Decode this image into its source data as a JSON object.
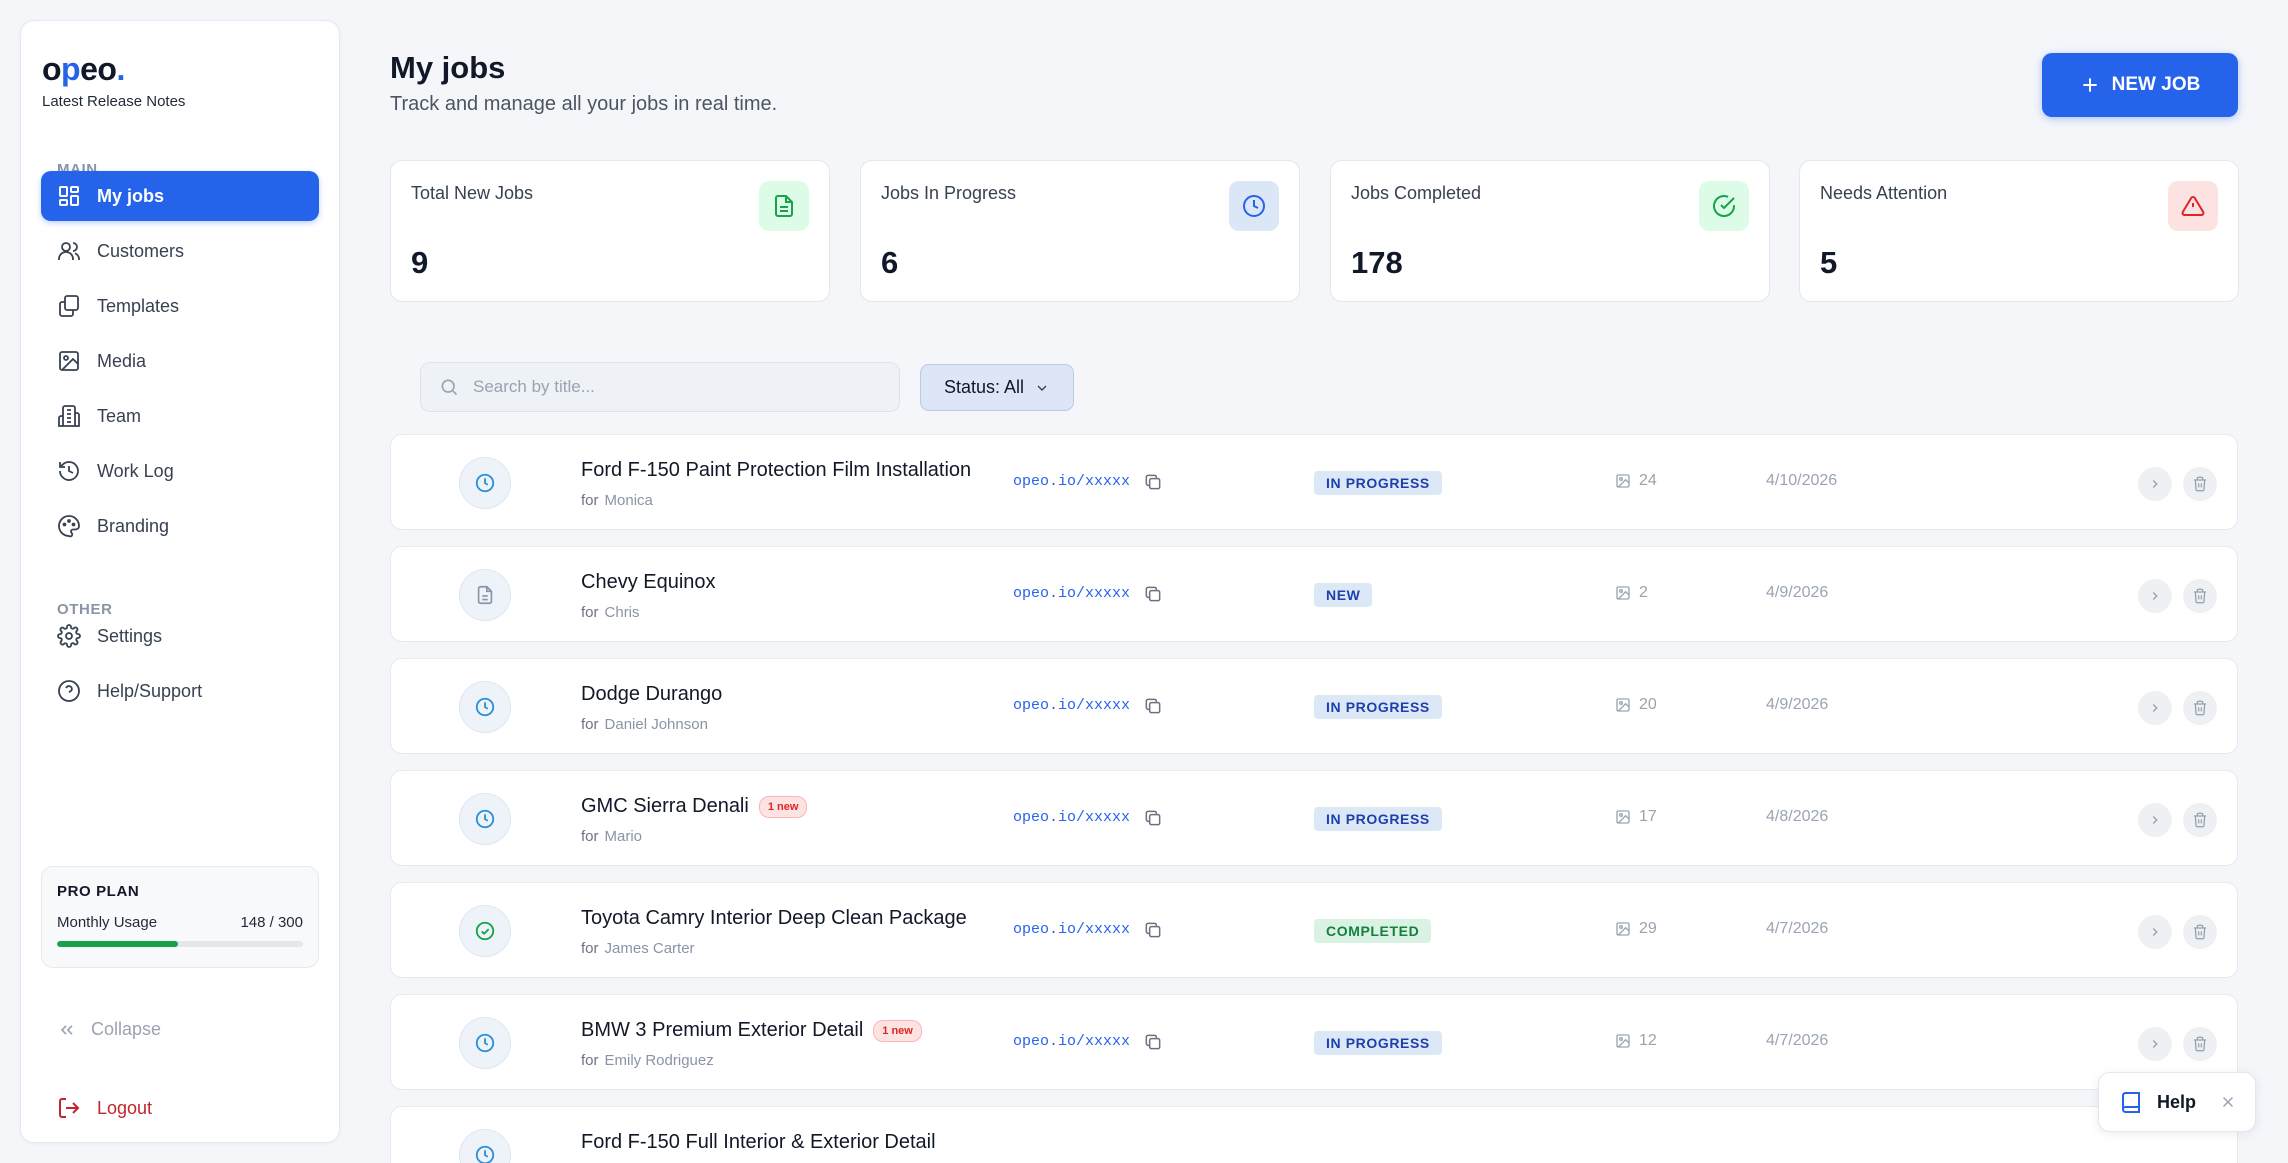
{
  "sidebar": {
    "logo_prefix": "o",
    "logo_accent": "p",
    "logo_suffix": "eo",
    "logo_dot": ".",
    "release_notes": "Latest Release Notes",
    "section_main": "MAIN",
    "section_other": "OTHER",
    "items": [
      {
        "label": "My jobs",
        "icon": "grid-icon"
      },
      {
        "label": "Customers",
        "icon": "users-icon"
      },
      {
        "label": "Templates",
        "icon": "copy-icon"
      },
      {
        "label": "Media",
        "icon": "image-icon"
      },
      {
        "label": "Team",
        "icon": "building-icon"
      },
      {
        "label": "Work Log",
        "icon": "history-icon"
      },
      {
        "label": "Branding",
        "icon": "palette-icon"
      }
    ],
    "other_items": [
      {
        "label": "Settings",
        "icon": "gear-icon"
      },
      {
        "label": "Help/Support",
        "icon": "help-circle-icon"
      }
    ],
    "plan": {
      "title": "PRO PLAN",
      "usage_label": "Monthly Usage",
      "usage_value": "148 / 300",
      "usage_fraction": 0.4933
    },
    "collapse_label": "Collapse",
    "logout_label": "Logout"
  },
  "header": {
    "title": "My jobs",
    "subtitle": "Track and manage all your jobs in real time.",
    "new_job_label": "NEW JOB"
  },
  "stats": [
    {
      "label": "Total New Jobs",
      "value": "9",
      "icon": "file-icon",
      "color": "#16a34a",
      "bg": "#dcfce7"
    },
    {
      "label": "Jobs In Progress",
      "value": "6",
      "icon": "clock-icon",
      "color": "#2563eb",
      "bg": "#dbe6f7"
    },
    {
      "label": "Jobs Completed",
      "value": "178",
      "icon": "check-circle-icon",
      "color": "#16a34a",
      "bg": "#dcfce7"
    },
    {
      "label": "Needs Attention",
      "value": "5",
      "icon": "alert-triangle-icon",
      "color": "#dc2626",
      "bg": "#fde2e2"
    }
  ],
  "filters": {
    "search_placeholder": "Search by title...",
    "status_label": "Status: All"
  },
  "jobs": [
    {
      "title": "Ford F-150 Paint Protection Film Installation",
      "for_label": "for",
      "customer": "Monica",
      "link": "opeo.io/xxxxx",
      "status": "IN PROGRESS",
      "media": "24",
      "date": "4/10/2026",
      "new_badge": ""
    },
    {
      "title": "Chevy Equinox",
      "for_label": "for",
      "customer": "Chris",
      "link": "opeo.io/xxxxx",
      "status": "NEW",
      "media": "2",
      "date": "4/9/2026",
      "new_badge": ""
    },
    {
      "title": "Dodge Durango",
      "for_label": "for",
      "customer": "Daniel Johnson",
      "link": "opeo.io/xxxxx",
      "status": "IN PROGRESS",
      "media": "20",
      "date": "4/9/2026",
      "new_badge": ""
    },
    {
      "title": "GMC Sierra Denali",
      "for_label": "for",
      "customer": "Mario",
      "link": "opeo.io/xxxxx",
      "status": "IN PROGRESS",
      "media": "17",
      "date": "4/8/2026",
      "new_badge": "1 new"
    },
    {
      "title": "Toyota Camry Interior Deep Clean Package",
      "for_label": "for",
      "customer": "James Carter",
      "link": "opeo.io/xxxxx",
      "status": "COMPLETED",
      "media": "29",
      "date": "4/7/2026",
      "new_badge": ""
    },
    {
      "title": "BMW 3 Premium Exterior Detail",
      "for_label": "for",
      "customer": "Emily Rodriguez",
      "link": "opeo.io/xxxxx",
      "status": "IN PROGRESS",
      "media": "12",
      "date": "4/7/2026",
      "new_badge": "1 new"
    },
    {
      "title": "Ford F-150 Full Interior & Exterior Detail",
      "for_label": "",
      "customer": "",
      "link": "",
      "status": "",
      "media": "",
      "date": "",
      "new_badge": ""
    }
  ],
  "help_widget": {
    "label": "Help"
  }
}
